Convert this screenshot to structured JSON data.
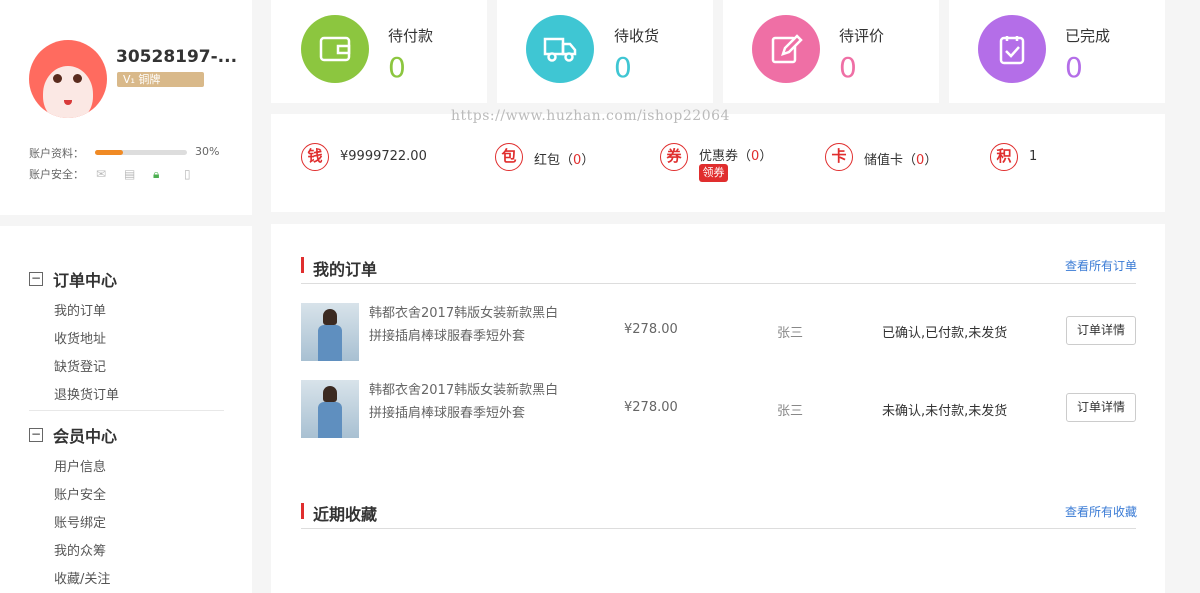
{
  "profile": {
    "username": "30528197-...",
    "vip_badge": "V₁ 铜牌",
    "account_info_label": "账户资料：",
    "account_info_progress": "30%",
    "account_security_label": "账户安全："
  },
  "sidebar": {
    "groups": [
      {
        "toggle": "−",
        "title": "订单中心",
        "items": [
          "我的订单",
          "收货地址",
          "缺货登记",
          "退换货订单"
        ]
      },
      {
        "toggle": "−",
        "title": "会员中心",
        "items": [
          "用户信息",
          "账户安全",
          "账号绑定",
          "我的众筹",
          "收藏/关注"
        ]
      }
    ]
  },
  "status_cards": [
    {
      "label": "待付款",
      "count": "0",
      "color": "#8cc63f",
      "icon": "wallet-icon"
    },
    {
      "label": "待收货",
      "count": "0",
      "color": "#3fc6d3",
      "icon": "truck-icon"
    },
    {
      "label": "待评价",
      "count": "0",
      "color": "#ef6fa5",
      "icon": "edit-icon"
    },
    {
      "label": "已完成",
      "count": "0",
      "color": "#b46ee8",
      "icon": "check-clipboard-icon"
    }
  ],
  "assets": {
    "money": {
      "icon": "钱",
      "value": "¥9999722.00"
    },
    "red_packet": {
      "icon": "包",
      "label": "红包",
      "count": "0"
    },
    "coupon": {
      "icon": "券",
      "label": "优惠券",
      "count": "0",
      "claim": "领券"
    },
    "card": {
      "icon": "卡",
      "label": "储值卡",
      "count": "0"
    },
    "points": {
      "icon": "积",
      "value": "1"
    }
  },
  "watermark": "https://www.huzhan.com/ishop22064",
  "orders": {
    "title": "我的订单",
    "view_all": "查看所有订单",
    "rows": [
      {
        "name": "韩都衣舍2017韩版女装新款黑白拼接插肩棒球服春季短外套",
        "price": "¥278.00",
        "buyer": "张三",
        "status": "已确认,已付款,未发货",
        "action": "订单详情"
      },
      {
        "name": "韩都衣舍2017韩版女装新款黑白拼接插肩棒球服春季短外套",
        "price": "¥278.00",
        "buyer": "张三",
        "status": "未确认,未付款,未发货",
        "action": "订单详情"
      }
    ]
  },
  "favorites": {
    "title": "近期收藏",
    "view_all": "查看所有收藏"
  },
  "colors": {
    "accent_red": "#e02e2e",
    "link_blue": "#3a7bd5",
    "progress_orange": "#f08a24"
  }
}
